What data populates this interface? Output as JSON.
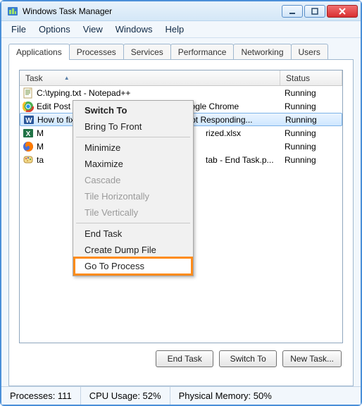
{
  "window": {
    "title": "Windows Task Manager"
  },
  "menubar": [
    "File",
    "Options",
    "View",
    "Windows",
    "Help"
  ],
  "tabs": [
    "Applications",
    "Processes",
    "Services",
    "Performance",
    "Networking",
    "Users"
  ],
  "active_tab": 0,
  "columns": {
    "task": "Task",
    "status": "Status"
  },
  "tasks": [
    {
      "icon": "notepadpp",
      "name": "C:\\typing.txt - Notepad++",
      "status": "Running"
    },
    {
      "icon": "chrome",
      "name": "Edit Post ‹ ultraali453 — WordPress - Google Chrome",
      "status": "Running"
    },
    {
      "icon": "word",
      "name": "How to fix the not responding error.doc Not Responding...",
      "status": "Running",
      "selected": true
    },
    {
      "icon": "excel",
      "name": "M                                                                     rized.xlsx",
      "status": "Running"
    },
    {
      "icon": "firefox",
      "name": "M",
      "status": "Running"
    },
    {
      "icon": "paint",
      "name": "ta                                                                     tab - End Task.p...",
      "status": "Running"
    }
  ],
  "context_menu": [
    {
      "label": "Switch To",
      "bold": true
    },
    {
      "label": "Bring To Front"
    },
    {
      "sep": true
    },
    {
      "label": "Minimize"
    },
    {
      "label": "Maximize"
    },
    {
      "label": "Cascade",
      "disabled": true
    },
    {
      "label": "Tile Horizontally",
      "disabled": true
    },
    {
      "label": "Tile Vertically",
      "disabled": true
    },
    {
      "sep": true
    },
    {
      "label": "End Task"
    },
    {
      "label": "Create Dump File"
    },
    {
      "label": "Go To Process",
      "highlighted": true
    }
  ],
  "buttons": {
    "end_task": "End Task",
    "switch_to": "Switch To",
    "new_task": "New Task..."
  },
  "statusbar": {
    "processes": "Processes: 111",
    "cpu": "CPU Usage: 52%",
    "mem": "Physical Memory: 50%"
  }
}
